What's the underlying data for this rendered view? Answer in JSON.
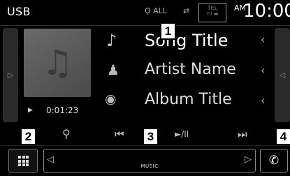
{
  "topbar": {
    "source_label": "USB",
    "status_icon_1": "Ϙ ALL",
    "status_icon_2": "⇄",
    "tel_top": "TEL",
    "tel_bottom": "Yıl ▬",
    "ampm": "AM",
    "clock": "10:00"
  },
  "callouts": {
    "c1": "1",
    "c2": "2",
    "c3": "3",
    "c4": "4"
  },
  "track": {
    "song_title": "Song Title",
    "artist_name": "Artist Name",
    "album_title": "Album Title",
    "elapsed": "0:01:23",
    "song_icon": "♪",
    "artist_icon": "♟",
    "album_icon": "◉",
    "chevron": "‹"
  },
  "controls": {
    "search_icon": "⚲",
    "prev_icon": "⏮",
    "playpause_icon": "►/II",
    "next_icon": "⏭"
  },
  "sidetabs": {
    "left_arrow": "▷",
    "right_arrow": "◁"
  },
  "bottom": {
    "media_label": "MUSIC",
    "left_arrow": "◁",
    "right_arrow": "▷",
    "phone_icon": "✆"
  },
  "icons": {
    "art": "music-note-icon",
    "menu": "grid-menu-icon",
    "phone": "phone-icon"
  }
}
